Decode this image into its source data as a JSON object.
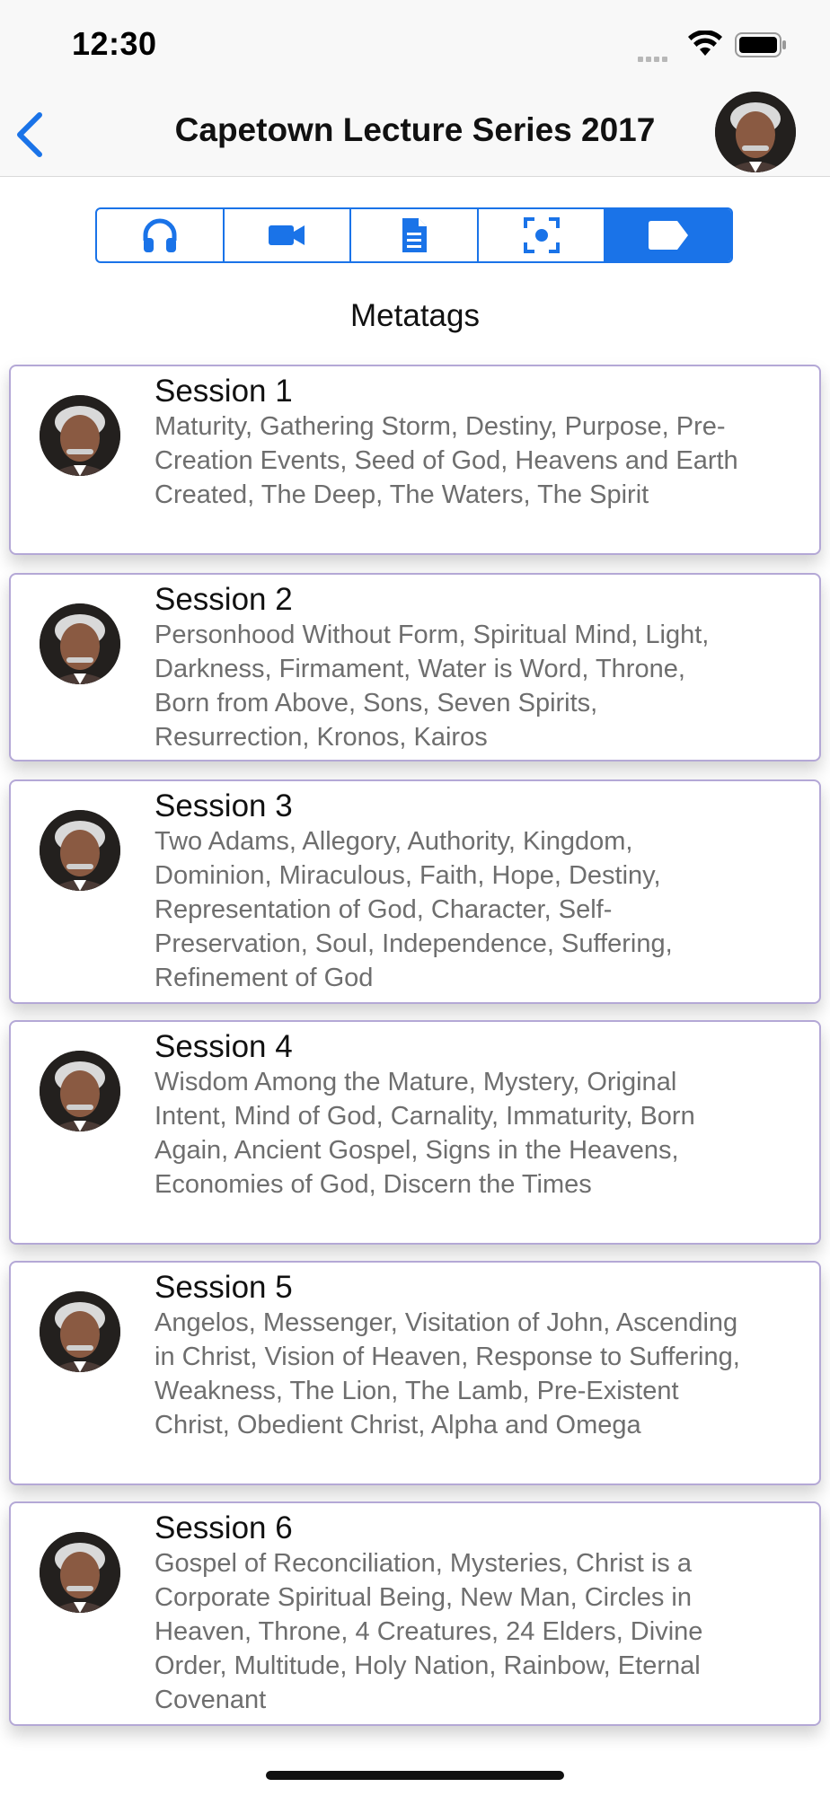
{
  "status_bar": {
    "time": "12:30"
  },
  "nav": {
    "title": "Capetown Lecture Series 2017"
  },
  "segments": [
    {
      "name": "audio",
      "icon": "headphones-icon"
    },
    {
      "name": "video",
      "icon": "video-camera-icon"
    },
    {
      "name": "document",
      "icon": "document-icon"
    },
    {
      "name": "focus",
      "icon": "focus-scan-icon"
    },
    {
      "name": "metatags",
      "icon": "tag-icon",
      "active": true
    }
  ],
  "section_title": "Metatags",
  "accent_color": "#1a73e8",
  "sessions": [
    {
      "name": "Session 1",
      "tags": "Maturity, Gathering Storm, Destiny, Purpose, Pre-Creation Events, Seed of God, Heavens and Earth Created, The Deep, The Waters, The Spirit"
    },
    {
      "name": "Session 2",
      "tags": "Personhood Without Form, Spiritual Mind, Light, Darkness, Firmament, Water is Word, Throne, Born from Above, Sons, Seven Spirits, Resurrection, Kronos, Kairos"
    },
    {
      "name": "Session 3",
      "tags": "Two Adams, Allegory, Authority, Kingdom, Dominion, Miraculous, Faith, Hope, Destiny, Representation of God, Character, Self-Preservation, Soul, Independence, Suffering, Refinement of God"
    },
    {
      "name": "Session 4",
      "tags": "Wisdom Among the Mature, Mystery, Original Intent, Mind of God, Carnality, Immaturity, Born Again, Ancient Gospel, Signs in the Heavens, Economies of God, Discern the Times"
    },
    {
      "name": "Session 5",
      "tags": "Angelos, Messenger, Visitation of John, Ascending in Christ, Vision of Heaven, Response to Suffering, Weakness, The Lion, The Lamb, Pre-Existent Christ, Obedient Christ, Alpha and Omega"
    },
    {
      "name": "Session 6",
      "tags": "Gospel of Reconciliation, Mysteries, Christ is a Corporate Spiritual Being, New Man, Circles in Heaven, Throne, 4 Creatures, 24 Elders, Divine Order, Multitude, Holy Nation, Rainbow, Eternal Covenant"
    }
  ]
}
